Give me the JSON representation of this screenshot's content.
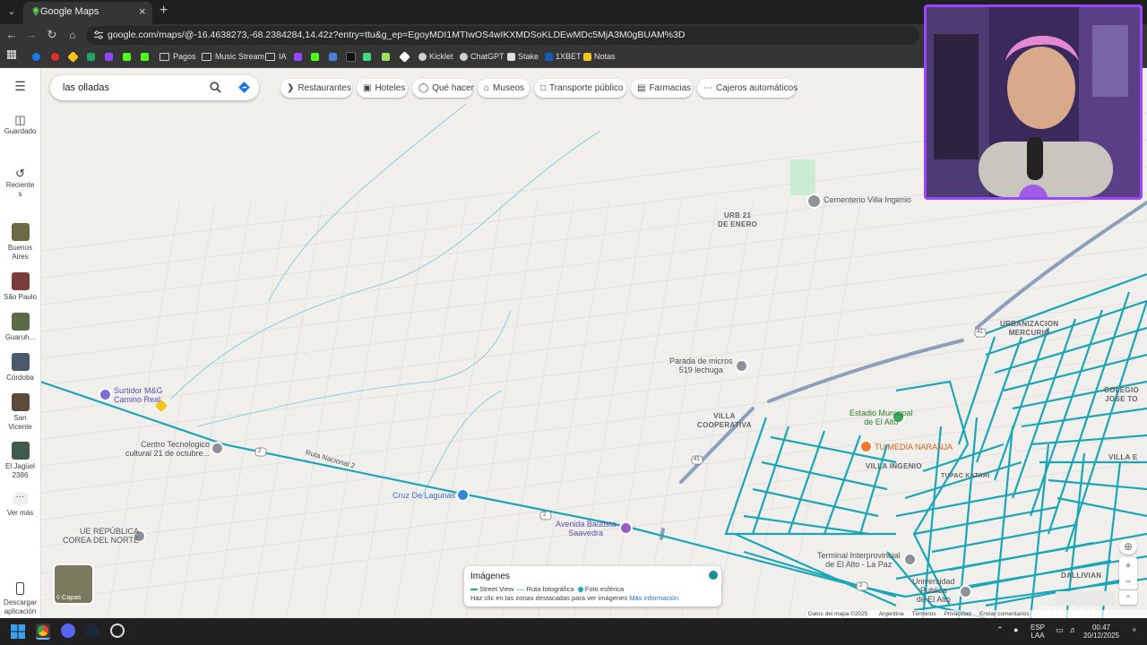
{
  "browser": {
    "tab_title": "Google Maps",
    "url": "google.com/maps/@-16.4638273,-68.2384284,14.42z?entry=ttu&g_ep=EgoyMDI1MTIwOS4wIKXMDSoKLDEwMDc5MjA3M0gBUAM%3D",
    "bookmarks": [
      "Pagos",
      "Music Stream",
      "IA",
      "Kicklet",
      "ChatGPT",
      "Stake",
      "1XBET",
      "Notas"
    ]
  },
  "rail": {
    "saved": "Guardado",
    "recents": "Reciente\ns",
    "items": [
      {
        "label": "Buenos\nAires",
        "color": "#6b6a45"
      },
      {
        "label": "São Paulo",
        "color": "#7a3b3b"
      },
      {
        "label": "Guaruh...",
        "color": "#5c6b45"
      },
      {
        "label": "Córdoba",
        "color": "#4a5a6a"
      },
      {
        "label": "San\nVicente",
        "color": "#5c4a3a"
      },
      {
        "label": "El Jagüel\n2386",
        "color": "#3f5a4a"
      }
    ],
    "more": "Ver más",
    "download": "Descargar\naplicación"
  },
  "search": {
    "value": "las olladas"
  },
  "chips": [
    "Restaurantes",
    "Hoteles",
    "Qué hacer",
    "Museos",
    "Transporte público",
    "Farmacias",
    "Cajeros automáticos"
  ],
  "map_labels": {
    "cementerio": "Cementerio Villa Ingenio",
    "urb21_l1": "URB 21",
    "urb21_l2": "DE ENERO",
    "urb_mercurio_l1": "URBANIZACION",
    "urb_mercurio_l2": "MERCURIO",
    "parada_l1": "Parada de micros",
    "parada_l2": "519 lechuga",
    "surtidor_l1": "Surtidor M&G",
    "surtidor_l2": "Camino Real",
    "centro_l1": "Centro Tecnologico",
    "centro_l2": "cultural 21 de octubre...",
    "ruta_nacional": "Ruta Nacional 2",
    "cruz": "Cruz De Lagunas",
    "avenida_l1": "Avenida Bautista",
    "avenida_l2": "Saavedra",
    "villa_coop_l1": "VILLA",
    "villa_coop_l2": "COOPERATIVA",
    "estadio_l1": "Estadio Municipal",
    "estadio_l2": "de El Alto",
    "tu_media": "TU MEDIA NARANJA",
    "villa_ingenio": "VILLA INGENIO",
    "tupac": "TUPAC KATARI",
    "colegio_l1": "COLEGIO",
    "colegio_l2": "JOSE TO",
    "villa_e": "VILLA E",
    "ue_l1": "UE REPÚBLICA",
    "ue_l2": "COREA DEL NORTE",
    "terminal_l1": "Terminal Interprovincial",
    "terminal_l2": "de El Alto - La Paz",
    "universidad_l1": "Universidad",
    "universidad_l2": "Publica",
    "universidad_l3": "de El Alto",
    "dallivian": "DALLIVIAN",
    "route_2": "2",
    "route_41": "41"
  },
  "imagery": {
    "title": "Imágenes",
    "legend": [
      "Street View",
      "Ruta fotográfica",
      "Foto esférica"
    ],
    "hint": "Haz clic en las zonas destacadas para ver imágenes",
    "more_link": "Más información"
  },
  "layers_label": "Capas",
  "attribution": [
    "Datos del mapa ©2025",
    "Argentina",
    "Términos",
    "Privacidad",
    "Enviar comentarios"
  ],
  "taskbar": {
    "lang_top": "ESP",
    "lang_bottom": "LAA",
    "time": "00:47",
    "date": "20/12/2025",
    "corsair": "CORSAIR"
  },
  "colors": {
    "streetview": "#1aa6b7",
    "webcam_border": "#9b45ff",
    "map_bg": "#f1efeb"
  }
}
